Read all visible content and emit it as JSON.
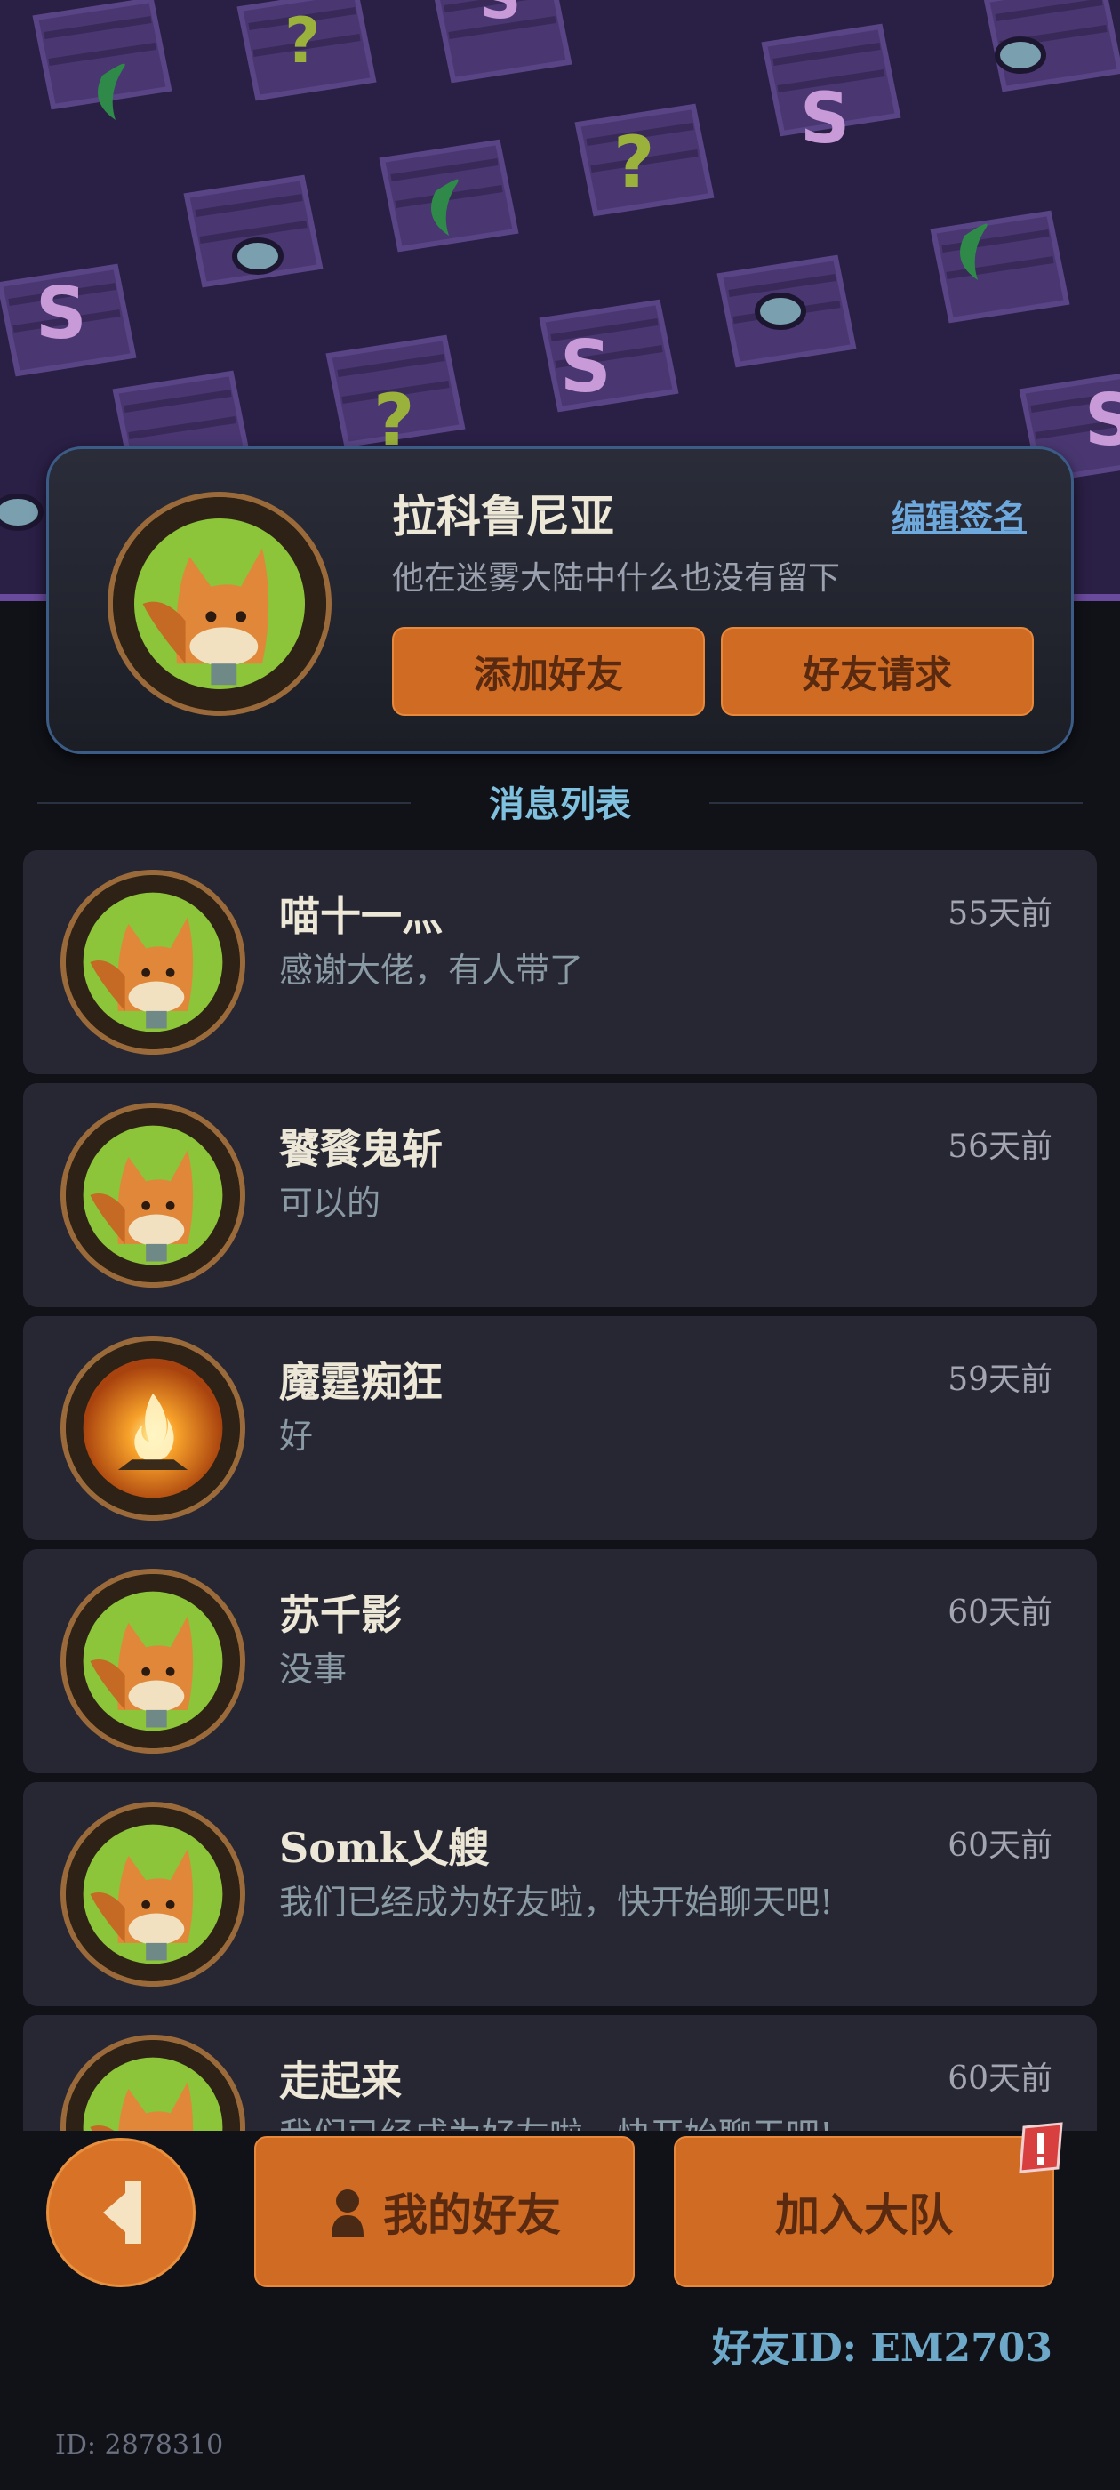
{
  "profile": {
    "name": "拉科鲁尼亚",
    "edit_label": "编辑签名",
    "signature": "他在迷雾大陆中什么也没有留下",
    "add_friend_label": "添加好友",
    "friend_request_label": "好友请求"
  },
  "section": {
    "title": "消息列表"
  },
  "messages": [
    {
      "name": "喵十一灬",
      "time": "55天前",
      "text": "感谢大佬，有人带了",
      "avatar": "fox-avatar-icon"
    },
    {
      "name": "饕餮鬼斩",
      "time": "56天前",
      "text": "可以的",
      "avatar": "fox-avatar-icon"
    },
    {
      "name": "魔霆痴狂",
      "time": "59天前",
      "text": "好",
      "avatar": "fire-avatar-icon"
    },
    {
      "name": "苏千影",
      "time": "60天前",
      "text": "没事",
      "avatar": "fox-avatar-icon"
    },
    {
      "name": "Somk乂艘",
      "time": "60天前",
      "text": "我们已经成为好友啦，快开始聊天吧!",
      "avatar": "fox-avatar-icon"
    },
    {
      "name": "走起来",
      "time": "60天前",
      "text": "我们已经成为好友啦，快开始聊天吧!",
      "avatar": "fox-avatar-icon"
    }
  ],
  "bottom": {
    "back_icon": "back-arrow-icon",
    "my_friends_label": "我的好友",
    "join_team_label": "加入大队",
    "alert_icon": "exclamation-badge-icon",
    "friend_id": "好友ID: EM2703",
    "user_id": "ID: 2878310"
  },
  "colors": {
    "accent": "#d06b24",
    "link": "#6ea9de",
    "background": "#111218",
    "card": "#262733"
  }
}
